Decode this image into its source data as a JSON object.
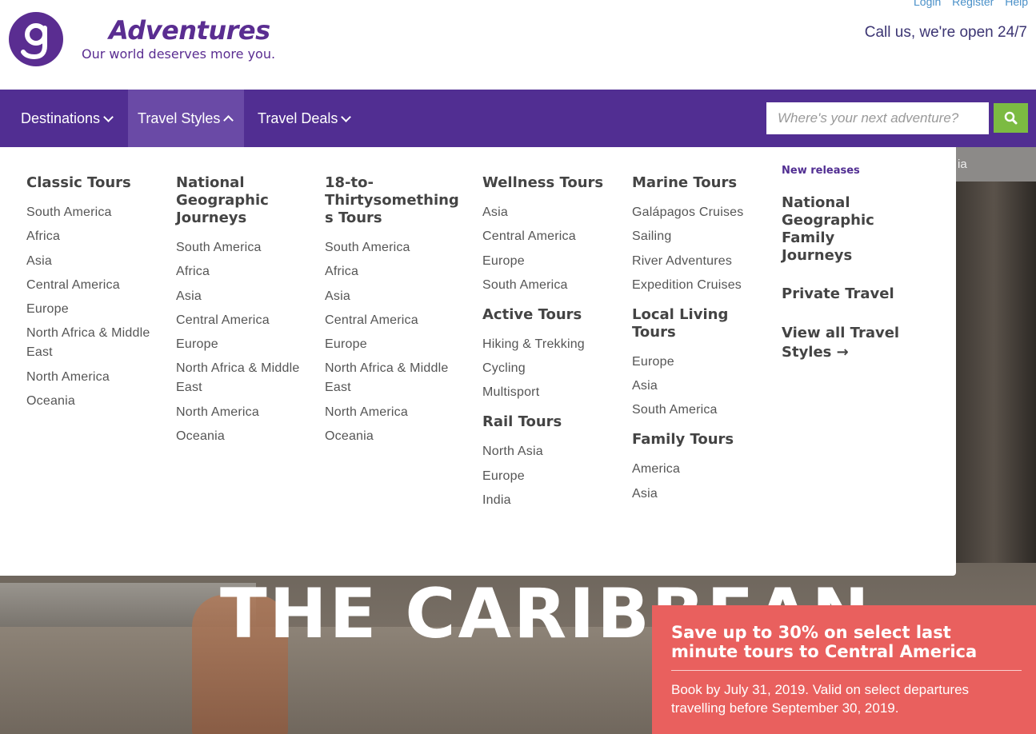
{
  "header": {
    "brand": "Adventures",
    "tagline": "Our world deserves more you.",
    "util_links": [
      "Login",
      "Register",
      "Help"
    ],
    "call": "Call us, we're open 24/7"
  },
  "nav": {
    "items": [
      "Destinations",
      "Travel Styles",
      "Travel Deals"
    ],
    "active": "Travel Styles",
    "search_placeholder": "Where's your next adventure?"
  },
  "mega_menu": {
    "classic": {
      "title": "Classic Tours",
      "links": [
        "South America",
        "Africa",
        "Asia",
        "Central America",
        "Europe",
        "North Africa & Middle East",
        "North America",
        "Oceania"
      ]
    },
    "natgeo": {
      "title": "National Geographic Journeys",
      "links": [
        "South America",
        "Africa",
        "Asia",
        "Central America",
        "Europe",
        "North Africa & Middle East",
        "North America",
        "Oceania"
      ]
    },
    "thirty": {
      "title": "18-to-Thirtysomethings Tours",
      "links": [
        "South America",
        "Africa",
        "Asia",
        "Central America",
        "Europe",
        "North Africa & Middle East",
        "North America",
        "Oceania"
      ]
    },
    "wellness": {
      "title": "Wellness Tours",
      "links": [
        "Asia",
        "Central America",
        "Europe",
        "South America"
      ]
    },
    "active": {
      "title": "Active Tours",
      "links": [
        "Hiking & Trekking",
        "Cycling",
        "Multisport"
      ]
    },
    "rail": {
      "title": "Rail Tours",
      "links": [
        "North Asia",
        "Europe",
        "India"
      ]
    },
    "marine": {
      "title": "Marine Tours",
      "links": [
        "Galápagos Cruises",
        "Sailing",
        "River Adventures",
        "Expedition Cruises"
      ]
    },
    "local": {
      "title": "Local Living Tours",
      "links": [
        "Europe",
        "Asia",
        "South America"
      ]
    },
    "family": {
      "title": "Family Tours",
      "links": [
        "America",
        "Asia"
      ]
    },
    "featured": {
      "label": "New releases",
      "items": [
        "National Geographic Family Journeys",
        "Private Travel",
        "View all Travel Styles →"
      ]
    }
  },
  "hero": {
    "title": "THE CARIBBEAN",
    "side_tab": "ia"
  },
  "promo": {
    "title": "Save up to 30% on select last minute tours to Central America",
    "text": "Book by July 31, 2019. Valid on select departures travelling before September 30, 2019."
  },
  "colors": {
    "brand_purple": "#512e92",
    "search_green": "#7cbb42",
    "promo_red": "#e9605e"
  }
}
